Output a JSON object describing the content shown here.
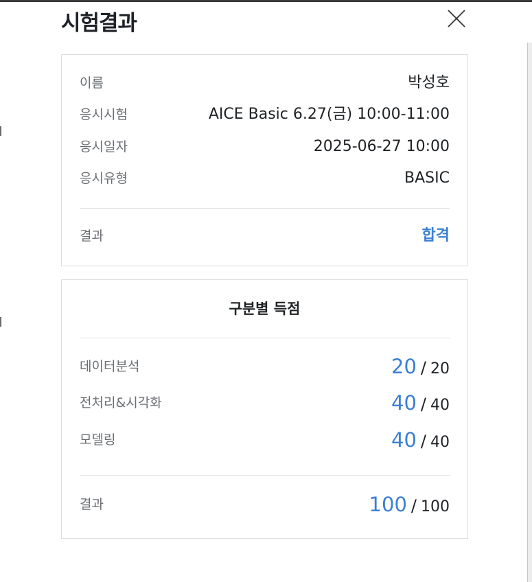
{
  "modal": {
    "title": "시험결과"
  },
  "info": {
    "rows": [
      {
        "label": "이름",
        "value": "박성호"
      },
      {
        "label": "응시시험",
        "value": "AICE Basic 6.27(금) 10:00-11:00"
      },
      {
        "label": "응시일자",
        "value": "2025-06-27 10:00"
      },
      {
        "label": "응시유형",
        "value": "BASIC"
      }
    ],
    "result_label": "결과",
    "result_value": "합격"
  },
  "scores": {
    "title": "구분별 득점",
    "rows": [
      {
        "label": "데이터분석",
        "score": "20",
        "max": "20"
      },
      {
        "label": "전처리&시각화",
        "score": "40",
        "max": "40"
      },
      {
        "label": "모델링",
        "score": "40",
        "max": "40"
      }
    ],
    "separator": "/",
    "total_label": "결과",
    "total_score": "100",
    "total_max": "100"
  },
  "colors": {
    "accent": "#3b7fd4",
    "text": "#1f2225",
    "label": "#6b6f74",
    "border": "#dcdcdc"
  }
}
